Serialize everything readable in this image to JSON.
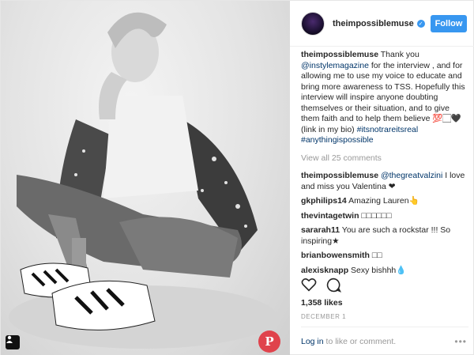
{
  "post": {
    "username": "theimpossiblemuse",
    "follow_label": "Follow",
    "caption": {
      "username": "theimpossiblemuse",
      "part1": " Thank you ",
      "mention1": "@instylemagazine",
      "part2": " for the interview , and for allowing me to use my voice to educate and bring more awareness to TSS. Hopefully this interview will inspire anyone doubting themselves or their situation, and to give them faith and to help them believe ",
      "emoji": "💯🏻🖤",
      "part3": " (link in my bio) ",
      "tag1": "#itsnotrareitsreal",
      "tag2": "#anythingispossible"
    },
    "view_all": "View all 25 comments",
    "comments": [
      {
        "user": "theimpossiblemuse",
        "mention": "@thegreatvalzini",
        "text": " I love and miss you Valentina ❤"
      },
      {
        "user": "gkphilips14",
        "text": " Amazing Lauren👆"
      },
      {
        "user": "thevintagetwin",
        "text": " □□□□□□"
      },
      {
        "user": "sararah11",
        "text": " You are such a rockstar !!! So inspiring★"
      },
      {
        "user": "brianbowensmith",
        "text": " □□"
      },
      {
        "user": "alexisknapp",
        "text": " Sexy bishhh💧"
      }
    ],
    "likes": "1,358 likes",
    "date": "DECEMBER 1",
    "login_link": "Log in",
    "login_rest": " to like or comment.",
    "more": "•••"
  },
  "icons": {
    "like": "heart-icon",
    "comment": "comment-icon",
    "pin": "pinterest-icon",
    "tag": "user-tag-icon",
    "verified": "verified-badge-icon",
    "more": "more-options-icon"
  },
  "colors": {
    "accent": "#3897f0",
    "link": "#003569",
    "pinterest": "#e0434c"
  }
}
